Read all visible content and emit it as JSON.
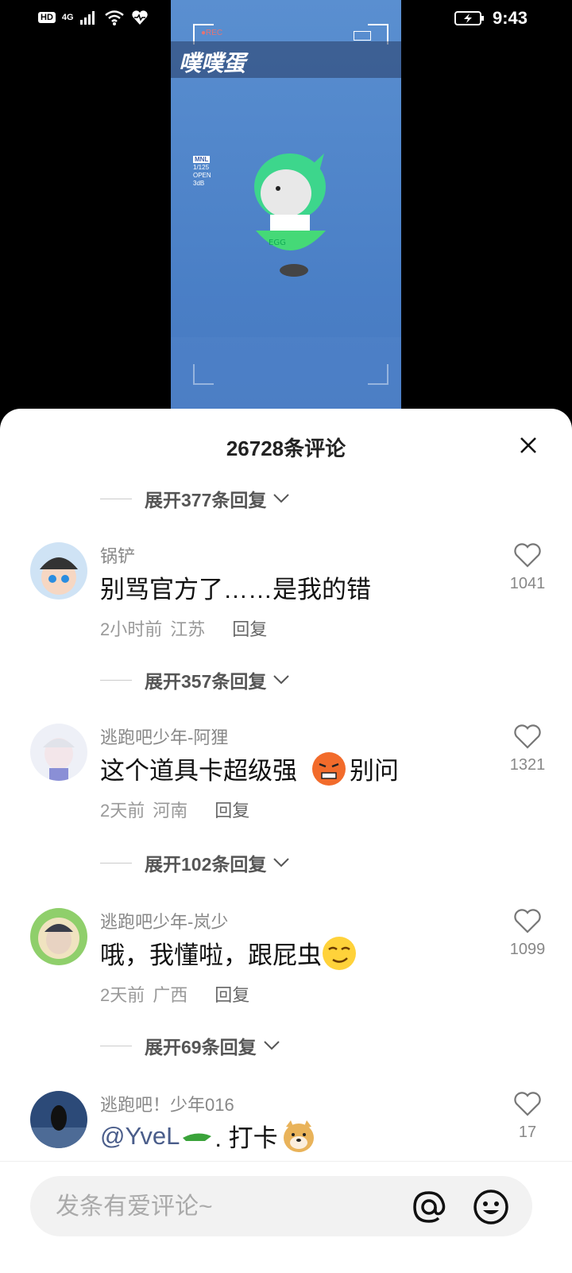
{
  "status_bar": {
    "hd_label": "HD",
    "network_label": "4G",
    "time": "9:43"
  },
  "video": {
    "title": "噗噗蛋",
    "rec_label": "●REC",
    "overlay_lines": [
      "MNL",
      "1/125",
      "OPEN",
      "3dB"
    ],
    "character_badge": "EGG"
  },
  "comments_panel": {
    "title": "26728条评论",
    "expand_rows": [
      "展开377条回复",
      "展开357条回复",
      "展开102条回复",
      "展开69条回复"
    ],
    "comments": [
      {
        "username": "锅铲",
        "text": "别骂官方了……是我的错",
        "time": "2小时前",
        "location": "江苏",
        "reply_label": "回复",
        "likes": "1041"
      },
      {
        "username": "逃跑吧少年-阿狸",
        "text": "这个道具卡超级强",
        "text_after_emoji": "别问",
        "emoji": "angry-face-emoji",
        "time": "2天前",
        "location": "河南",
        "reply_label": "回复",
        "likes": "1321"
      },
      {
        "username": "逃跑吧少年-岚少",
        "text": "哦，我懂啦，跟屁虫",
        "emoji": "smirk-face-emoji",
        "time": "2天前",
        "location": "广西",
        "reply_label": "回复",
        "likes": "1099"
      },
      {
        "username": "逃跑吧！少年016",
        "mention": "@YveL",
        "text_after_mention": ". 打卡",
        "emoji": "doge-emoji",
        "likes": "17"
      }
    ]
  },
  "input_bar": {
    "placeholder": "发条有爱评论~"
  },
  "colors": {
    "video_bg": "#4a7fc6",
    "mention": "#4a5d8a",
    "muted_text": "#888888"
  }
}
